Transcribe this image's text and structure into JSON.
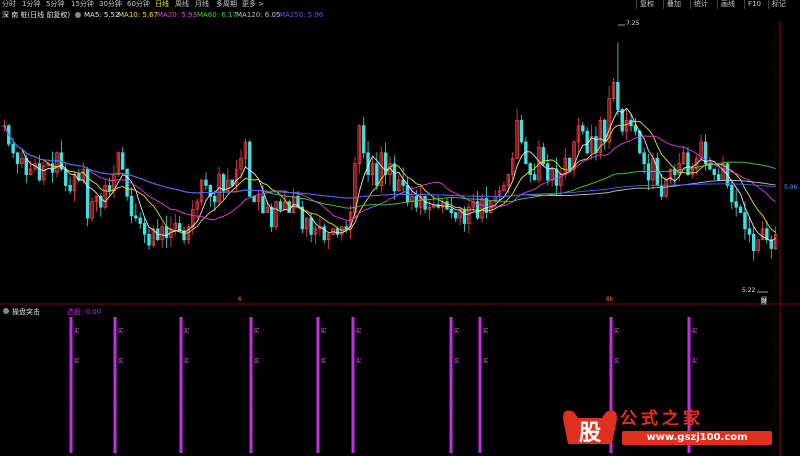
{
  "toolbar": {
    "periods": [
      "分时",
      "1分钟",
      "5分钟",
      "15分钟",
      "30分钟",
      "60分钟",
      "日线",
      "周线",
      "月线",
      "多周期",
      "更多 >"
    ],
    "active_period": "日线",
    "right_buttons": [
      "复权",
      "叠加",
      "统计",
      "画线",
      "F10",
      "标记"
    ]
  },
  "info": {
    "stock": "深 南 桩(日线 前复权)",
    "ma5": "MA5: 5.52",
    "ma10": "MA10: 5.67",
    "ma20": "MA20: 5.93",
    "ma60": "MA60: 6.17",
    "ma120": "MA120: 6.05",
    "ma250": "MA250: 5.96"
  },
  "colors": {
    "ma5": "#e8e8e8",
    "ma10": "#e8e020",
    "ma20": "#e040e0",
    "ma60": "#40d040",
    "ma120": "#c0c0c0",
    "ma250": "#4060ff",
    "up": "#ff4040",
    "down": "#40e0e0",
    "grid": "#4a0000",
    "signal": "#c030e0"
  },
  "main_chart": {
    "high_label": "7.25",
    "low_label": "5.22",
    "price_tag": "5.96",
    "markers": [
      "6",
      "8k",
      "财"
    ]
  },
  "indicator": {
    "name": "操盘突击",
    "value_label": "选股: 0.00",
    "signal_mark": "买"
  },
  "chart_data": {
    "type": "candlestick",
    "values": [
      6.55,
      6.38,
      6.3,
      6.2,
      6.25,
      6.1,
      6.15,
      6.2,
      6.05,
      6.18,
      6.2,
      6.12,
      6.3,
      6.15,
      6.0,
      5.95,
      6.1,
      6.05,
      6.15,
      5.7,
      5.85,
      5.9,
      5.8,
      6.0,
      5.95,
      6.1,
      6.3,
      6.15,
      5.9,
      5.72,
      5.7,
      5.65,
      5.55,
      5.45,
      5.6,
      5.5,
      5.62,
      5.52,
      5.6,
      5.65,
      5.58,
      5.5,
      5.62,
      5.78,
      5.85,
      6.05,
      6.0,
      5.9,
      5.85,
      6.1,
      5.95,
      6.05,
      6.0,
      6.15,
      6.25,
      6.4,
      5.9,
      5.85,
      5.9,
      5.75,
      5.8,
      5.62,
      5.85,
      5.78,
      5.85,
      5.75,
      5.9,
      5.8,
      5.6,
      5.7,
      5.55,
      5.6,
      5.62,
      5.5,
      5.55,
      5.6,
      5.55,
      5.62,
      5.6,
      5.75,
      6.2,
      6.55,
      6.3,
      6.1,
      6.2,
      6.0,
      6.3,
      6.1,
      6.2,
      5.95,
      6.05,
      6.0,
      5.85,
      5.9,
      5.8,
      5.9,
      5.78,
      5.8,
      5.82,
      5.8,
      5.85,
      5.78,
      5.75,
      5.7,
      5.78,
      5.65,
      5.8,
      5.85,
      5.7,
      5.88,
      5.75,
      5.85,
      5.9,
      5.95,
      6.0,
      6.1,
      6.25,
      6.6,
      6.4,
      6.2,
      6.1,
      6.05,
      6.35,
      6.2,
      6.05,
      6.15,
      6.0,
      6.1,
      6.25,
      6.15,
      6.4,
      6.55,
      6.5,
      6.3,
      6.45,
      6.3,
      6.6,
      6.4,
      6.8,
      6.95,
      6.7,
      6.5,
      6.6,
      6.55,
      6.5,
      6.3,
      6.2,
      6.05,
      6.25,
      6.0,
      5.9,
      6.05,
      6.15,
      6.1,
      6.2,
      6.3,
      6.1,
      6.15,
      6.25,
      6.4,
      6.2,
      6.15,
      6.1,
      6.05,
      6.2,
      6.0,
      5.85,
      5.8,
      5.75,
      5.6,
      5.55,
      5.4,
      5.5,
      5.6,
      5.5,
      5.42,
      5.55
    ]
  }
}
